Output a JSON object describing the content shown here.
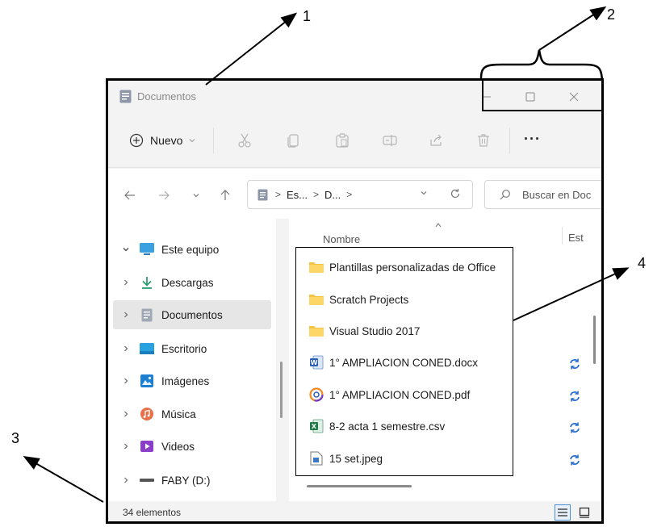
{
  "window": {
    "title": "Documentos",
    "controls": {
      "minimize": "minimize-icon",
      "maximize": "maximize-icon",
      "close": "close-icon"
    }
  },
  "toolbar": {
    "new_label": "Nuevo",
    "actions": [
      "cut-icon",
      "copy-icon",
      "paste-icon",
      "rename-icon",
      "share-icon",
      "delete-icon"
    ],
    "more_label": "···"
  },
  "address": {
    "crumbs": [
      "Es...",
      "D..."
    ],
    "separator": ">",
    "search_placeholder": "Buscar en Doc"
  },
  "sidebar": {
    "items": [
      {
        "label": "Este equipo",
        "icon": "computer-icon",
        "expanded": true
      },
      {
        "label": "Descargas",
        "icon": "download-icon"
      },
      {
        "label": "Documentos",
        "icon": "document-icon",
        "selected": true
      },
      {
        "label": "Escritorio",
        "icon": "desktop-icon"
      },
      {
        "label": "Imágenes",
        "icon": "pictures-icon"
      },
      {
        "label": "Música",
        "icon": "music-icon"
      },
      {
        "label": "Videos",
        "icon": "video-icon"
      },
      {
        "label": "FABY (D:)",
        "icon": "drive-icon"
      }
    ]
  },
  "content": {
    "columns": [
      "Nombre",
      "Est"
    ],
    "files": [
      {
        "name": "Plantillas personalizadas de Office",
        "icon": "folder-icon"
      },
      {
        "name": "Scratch Projects",
        "icon": "folder-icon"
      },
      {
        "name": "Visual Studio 2017",
        "icon": "folder-icon"
      },
      {
        "name": "1° AMPLIACION CONED.docx",
        "icon": "word-file-icon",
        "status": "sync-icon"
      },
      {
        "name": "1° AMPLIACION CONED.pdf",
        "icon": "pdf-file-icon",
        "status": "sync-icon"
      },
      {
        "name": "8-2 acta 1 semestre.csv",
        "icon": "excel-file-icon",
        "status": "sync-icon"
      },
      {
        "name": "15 set.jpeg",
        "icon": "image-file-icon",
        "status": "sync-icon"
      }
    ]
  },
  "status": {
    "count": "34 elementos"
  },
  "annotations": {
    "one": "1",
    "two": "2",
    "three": "3",
    "four": "4"
  },
  "colors": {
    "folder": "#f5c342",
    "sync": "#2f6fd0",
    "accent": "#4a90d9"
  }
}
